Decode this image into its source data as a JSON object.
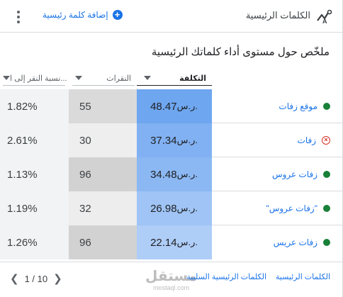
{
  "header": {
    "title": "الكلمات الرئيسية",
    "add_label": "إضافة كلمة رئيسية"
  },
  "subtitle": "ملخّص حول مستوى أداء كلماتك الرئيسية",
  "columns": {
    "cost": "التكلفة",
    "clicks": "النقرات",
    "ctr": "نسبة النقر إلى ا..."
  },
  "currency": "ر.س.",
  "rows": [
    {
      "keyword": "موقع زفات",
      "status": "active",
      "cost": "48.47",
      "clicks": "55",
      "ctr": "1.82%"
    },
    {
      "keyword": "زفات",
      "status": "removed",
      "cost": "37.34",
      "clicks": "30",
      "ctr": "2.61%"
    },
    {
      "keyword": "زفات عروس",
      "status": "active",
      "cost": "34.48",
      "clicks": "96",
      "ctr": "1.13%"
    },
    {
      "keyword": "\"زفات عروس\"",
      "status": "active",
      "cost": "26.98",
      "clicks": "32",
      "ctr": "1.19%"
    },
    {
      "keyword": "زفات عريس",
      "status": "active",
      "cost": "22.14",
      "clicks": "96",
      "ctr": "1.26%"
    }
  ],
  "heat": {
    "cost": [
      "#6ea6f0",
      "#81b1f2",
      "#8bb8f3",
      "#9fc4f5",
      "#aecdf7"
    ],
    "clicks": [
      "#dadada",
      "#eeeeee",
      "#d2d2d2",
      "#ededed",
      "#d2d2d2"
    ]
  },
  "status_colors": {
    "active": "#188038",
    "removed": "#d93025"
  },
  "footer": {
    "pager": "1 / 10",
    "tab_keywords": "الكلمات الرئيسية",
    "tab_negative": "الكلمات الرئيسية السلبية"
  },
  "watermark": {
    "big": "مستقل",
    "small": "mostaql.com"
  }
}
